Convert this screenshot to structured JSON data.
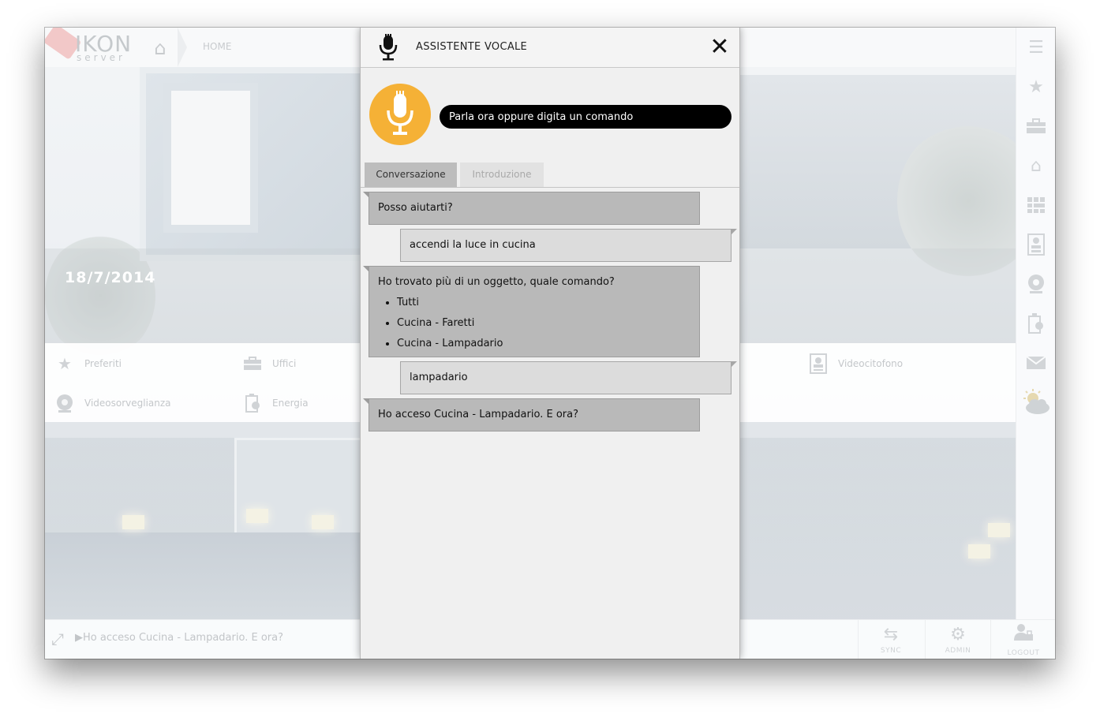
{
  "app": {
    "logo_text": "IKON",
    "logo_subtext": "server",
    "breadcrumb": {
      "home_label": "HOME"
    },
    "date": "18/7/2014"
  },
  "menu": {
    "items": [
      {
        "label": "Preferiti",
        "icon": "star-icon"
      },
      {
        "label": "Uffici",
        "icon": "briefcase-icon"
      },
      {
        "label": "Videocitofono",
        "icon": "intercom-icon"
      },
      {
        "label": "Videosorveglianza",
        "icon": "camera-icon"
      },
      {
        "label": "Energia",
        "icon": "energy-icon"
      }
    ]
  },
  "sidebar": {
    "items": [
      "menu-icon",
      "star-icon",
      "briefcase-icon",
      "home-icon",
      "grid-icon",
      "intercom-icon",
      "camera-icon",
      "energy-icon",
      "mail-icon",
      "weather-icon"
    ]
  },
  "footer": {
    "message": "Ho acceso Cucina - Lampadario. E ora?",
    "buttons": [
      {
        "label": "SYNC",
        "icon": "sync-icon"
      },
      {
        "label": "ADMIN",
        "icon": "gear-icon"
      },
      {
        "label": "LOGOUT",
        "icon": "user-lock-icon"
      }
    ]
  },
  "dialog": {
    "title": "ASSISTENTE VOCALE",
    "close_icon": "close-icon",
    "input_placeholder": "Parla ora oppure digita un comando",
    "accent_color": "#f5b136",
    "tabs": [
      {
        "label": "Conversazione",
        "active": true
      },
      {
        "label": "Introduzione",
        "active": false
      }
    ],
    "conversation": [
      {
        "role": "assistant",
        "text": "Posso aiutarti?"
      },
      {
        "role": "user",
        "text": "accendi la luce in cucina"
      },
      {
        "role": "assistant",
        "text": "Ho trovato più di un oggetto, quale comando?",
        "options": [
          "Tutti",
          "Cucina - Faretti",
          "Cucina - Lampadario"
        ]
      },
      {
        "role": "user",
        "text": "lampadario"
      },
      {
        "role": "assistant",
        "text": "Ho acceso Cucina - Lampadario. E ora?"
      }
    ]
  }
}
